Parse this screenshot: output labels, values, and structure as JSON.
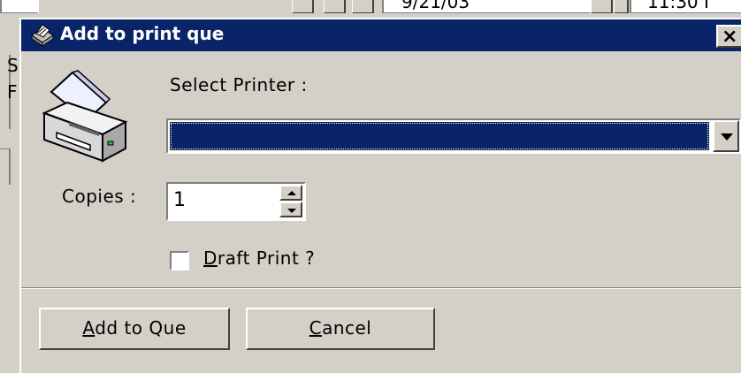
{
  "background": {
    "top_left_text": "",
    "top_middle_text": "9/21/03",
    "top_right_text": "11:30 I",
    "left_letters": [
      "S",
      "F"
    ]
  },
  "dialog": {
    "title": "Add to print que",
    "close_label": "×",
    "title_icon": "printer-small-icon",
    "printer_icon": "printer-icon"
  },
  "select_printer": {
    "label": "Select Printer :",
    "value": ""
  },
  "copies": {
    "label": "Copies :",
    "value": "1"
  },
  "draft_print": {
    "label_mnemonic": "D",
    "label_rest": "raft Print ?",
    "checked": false
  },
  "buttons": {
    "add_mnemonic": "A",
    "add_rest": "dd to Que",
    "cancel_mnemonic": "C",
    "cancel_rest": "ancel"
  },
  "colors": {
    "titlebar": "#0a246a",
    "face": "#d4d0c8",
    "selection": "#0a246a"
  }
}
